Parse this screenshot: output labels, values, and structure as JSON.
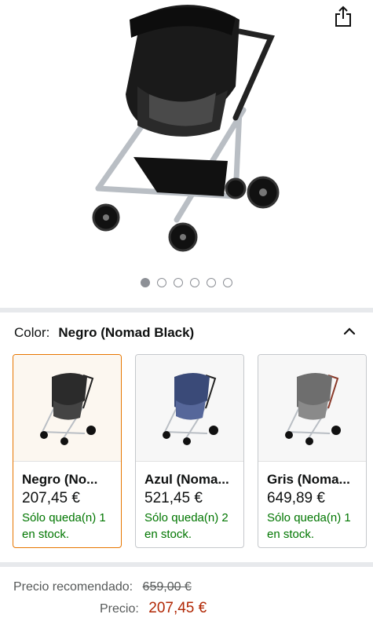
{
  "gallery": {
    "image_alt": "Maxi-Cosi Lila stroller",
    "dot_count": 6,
    "active_dot": 0
  },
  "color_selector": {
    "label": "Color:",
    "selected": "Negro (Nomad Black)"
  },
  "variants": [
    {
      "name": "Negro (No...",
      "price": "207,45 €",
      "stock": "Sólo queda(n) 1 en stock.",
      "selected": true,
      "color": "#2b2b2b"
    },
    {
      "name": "Azul (Noma...",
      "price": "521,45 €",
      "stock": "Sólo queda(n) 2 en stock.",
      "selected": false,
      "color": "#3a4a78"
    },
    {
      "name": "Gris (Noma...",
      "price": "649,89 €",
      "stock": "Sólo queda(n) 1 en stock.",
      "selected": false,
      "color": "#6e6e6e"
    }
  ],
  "pricing": {
    "recommended_label": "Precio recomendado:",
    "recommended_value": "659,00 €",
    "price_label": "Precio:",
    "price_value": "207,45 €"
  },
  "colors": {
    "selected_border": "#e77600",
    "stock_green": "#007600",
    "price_red": "#b12704"
  }
}
